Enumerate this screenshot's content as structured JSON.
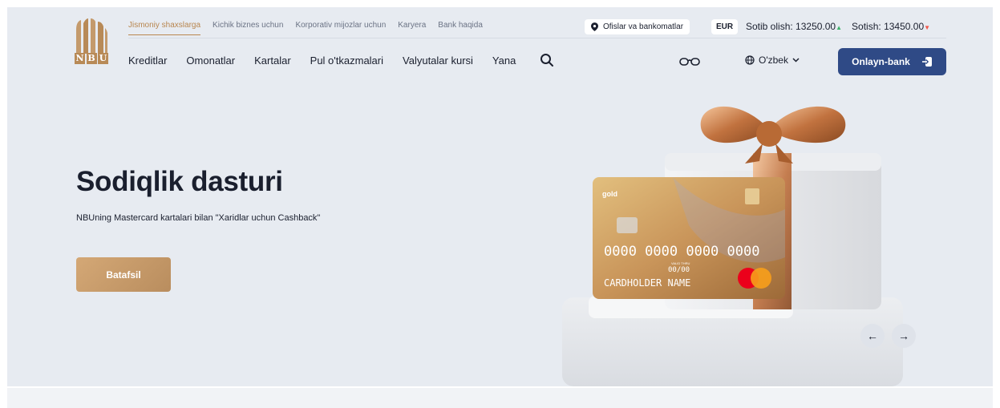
{
  "logo": {
    "letters": [
      "N",
      "B",
      "U"
    ]
  },
  "top_links": [
    "Jismoniy shaxslarga",
    "Kichik biznes uchun",
    "Korporativ mijozlar uchun",
    "Karyera",
    "Bank haqida"
  ],
  "offices_label": "Ofislar va bankomatlar",
  "currency": "EUR",
  "rates": {
    "buy_label": "Sotib olish:",
    "buy_value": "13250.00",
    "sell_label": "Sotish:",
    "sell_value": "13450.00"
  },
  "nav": [
    "Kreditlar",
    "Omonatlar",
    "Kartalar",
    "Pul o'tkazmalari",
    "Valyutalar kursi",
    "Yana"
  ],
  "language": "O'zbek",
  "online_bank_label": "Onlayn-bank",
  "hero": {
    "title": "Sodiqlik dasturi",
    "subtitle": "NBUning Mastercard kartalari bilan \"Xaridlar uchun Cashback\"",
    "button": "Batafsil"
  },
  "card": {
    "brand": "gold",
    "number": "0000 0000 0000 0000",
    "valid_label": "VALID THRU",
    "expiry": "00/00",
    "holder": "CARDHOLDER NAME"
  },
  "carousel": {
    "prev": "←",
    "next": "→"
  },
  "icons": [
    "location-pin-icon",
    "search-icon",
    "glasses-icon",
    "globe-icon",
    "chevron-down-icon",
    "login-icon"
  ],
  "colors": {
    "accent_gold": "#b8864f",
    "primary_blue": "#2f4a86",
    "background": "#e7ebf1"
  }
}
